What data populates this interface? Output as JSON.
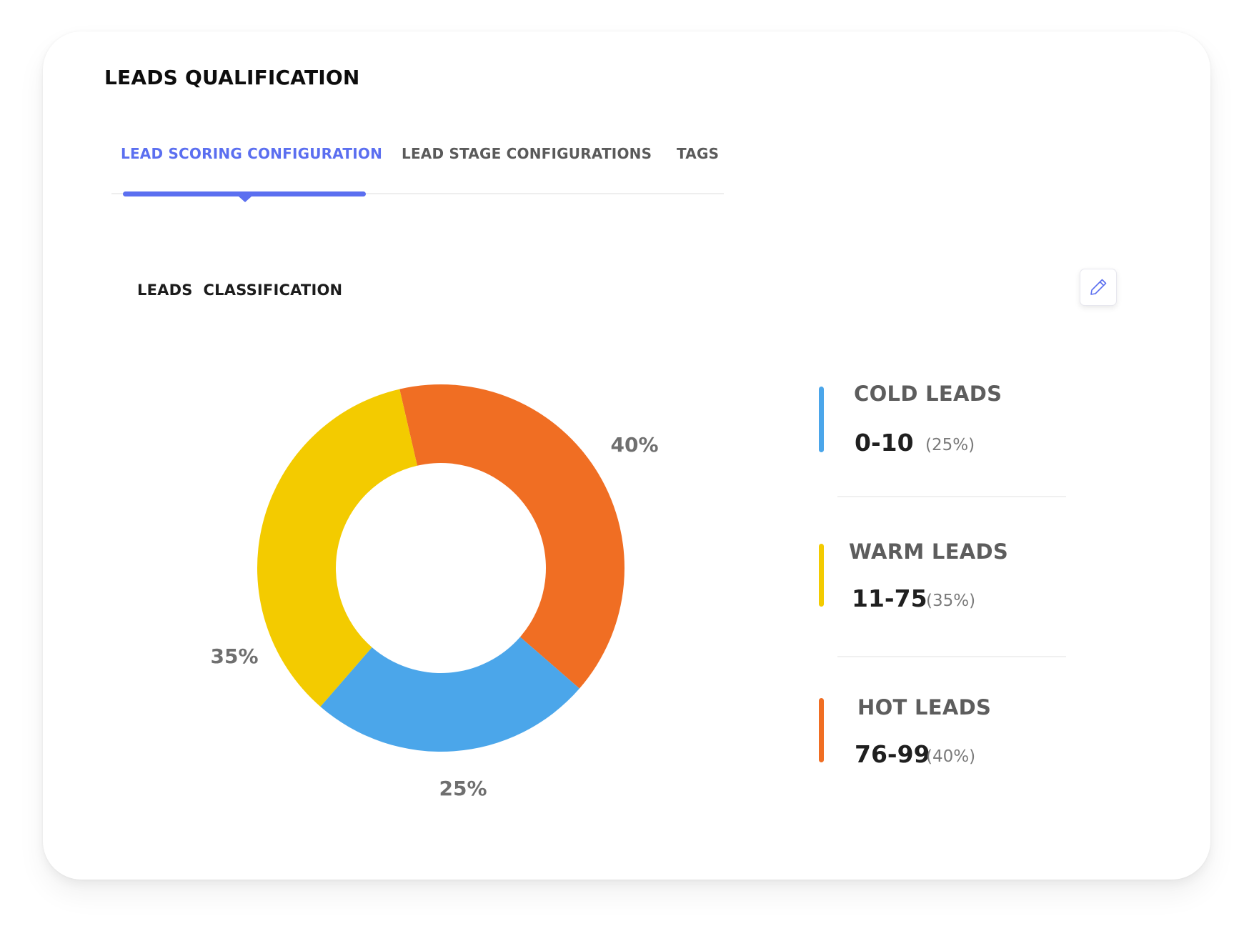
{
  "page": {
    "title": "LEADS QUALIFICATION"
  },
  "tabs": [
    {
      "label": "LEAD SCORING CONFIGURATION",
      "active": true
    },
    {
      "label": "LEAD STAGE CONFIGURATIONS",
      "active": false
    },
    {
      "label": "TAGS",
      "active": false
    }
  ],
  "section": {
    "title": "LEADS  CLASSIFICATION",
    "edit_icon": "pencil-icon"
  },
  "colors": {
    "accent": "#5b6ff0",
    "cold": "#4ba6ea",
    "warm": "#f3cb00",
    "hot": "#f06e23"
  },
  "legend": [
    {
      "title": "COLD LEADS",
      "range": "0-10",
      "percent": "(25%)",
      "color": "#4ba6ea"
    },
    {
      "title": "WARM LEADS",
      "range": "11-75",
      "percent": "(35%)",
      "color": "#f3cb00"
    },
    {
      "title": "HOT LEADS",
      "range": "76-99",
      "percent": "(40%)",
      "color": "#f06e23"
    }
  ],
  "chart_data": {
    "type": "pie",
    "donut": true,
    "categories": [
      "HOT LEADS",
      "COLD LEADS",
      "WARM LEADS"
    ],
    "values": [
      40,
      25,
      35
    ],
    "value_labels": [
      "40%",
      "25%",
      "35%"
    ],
    "colors": [
      "#f06e23",
      "#4ba6ea",
      "#f3cb00"
    ]
  }
}
